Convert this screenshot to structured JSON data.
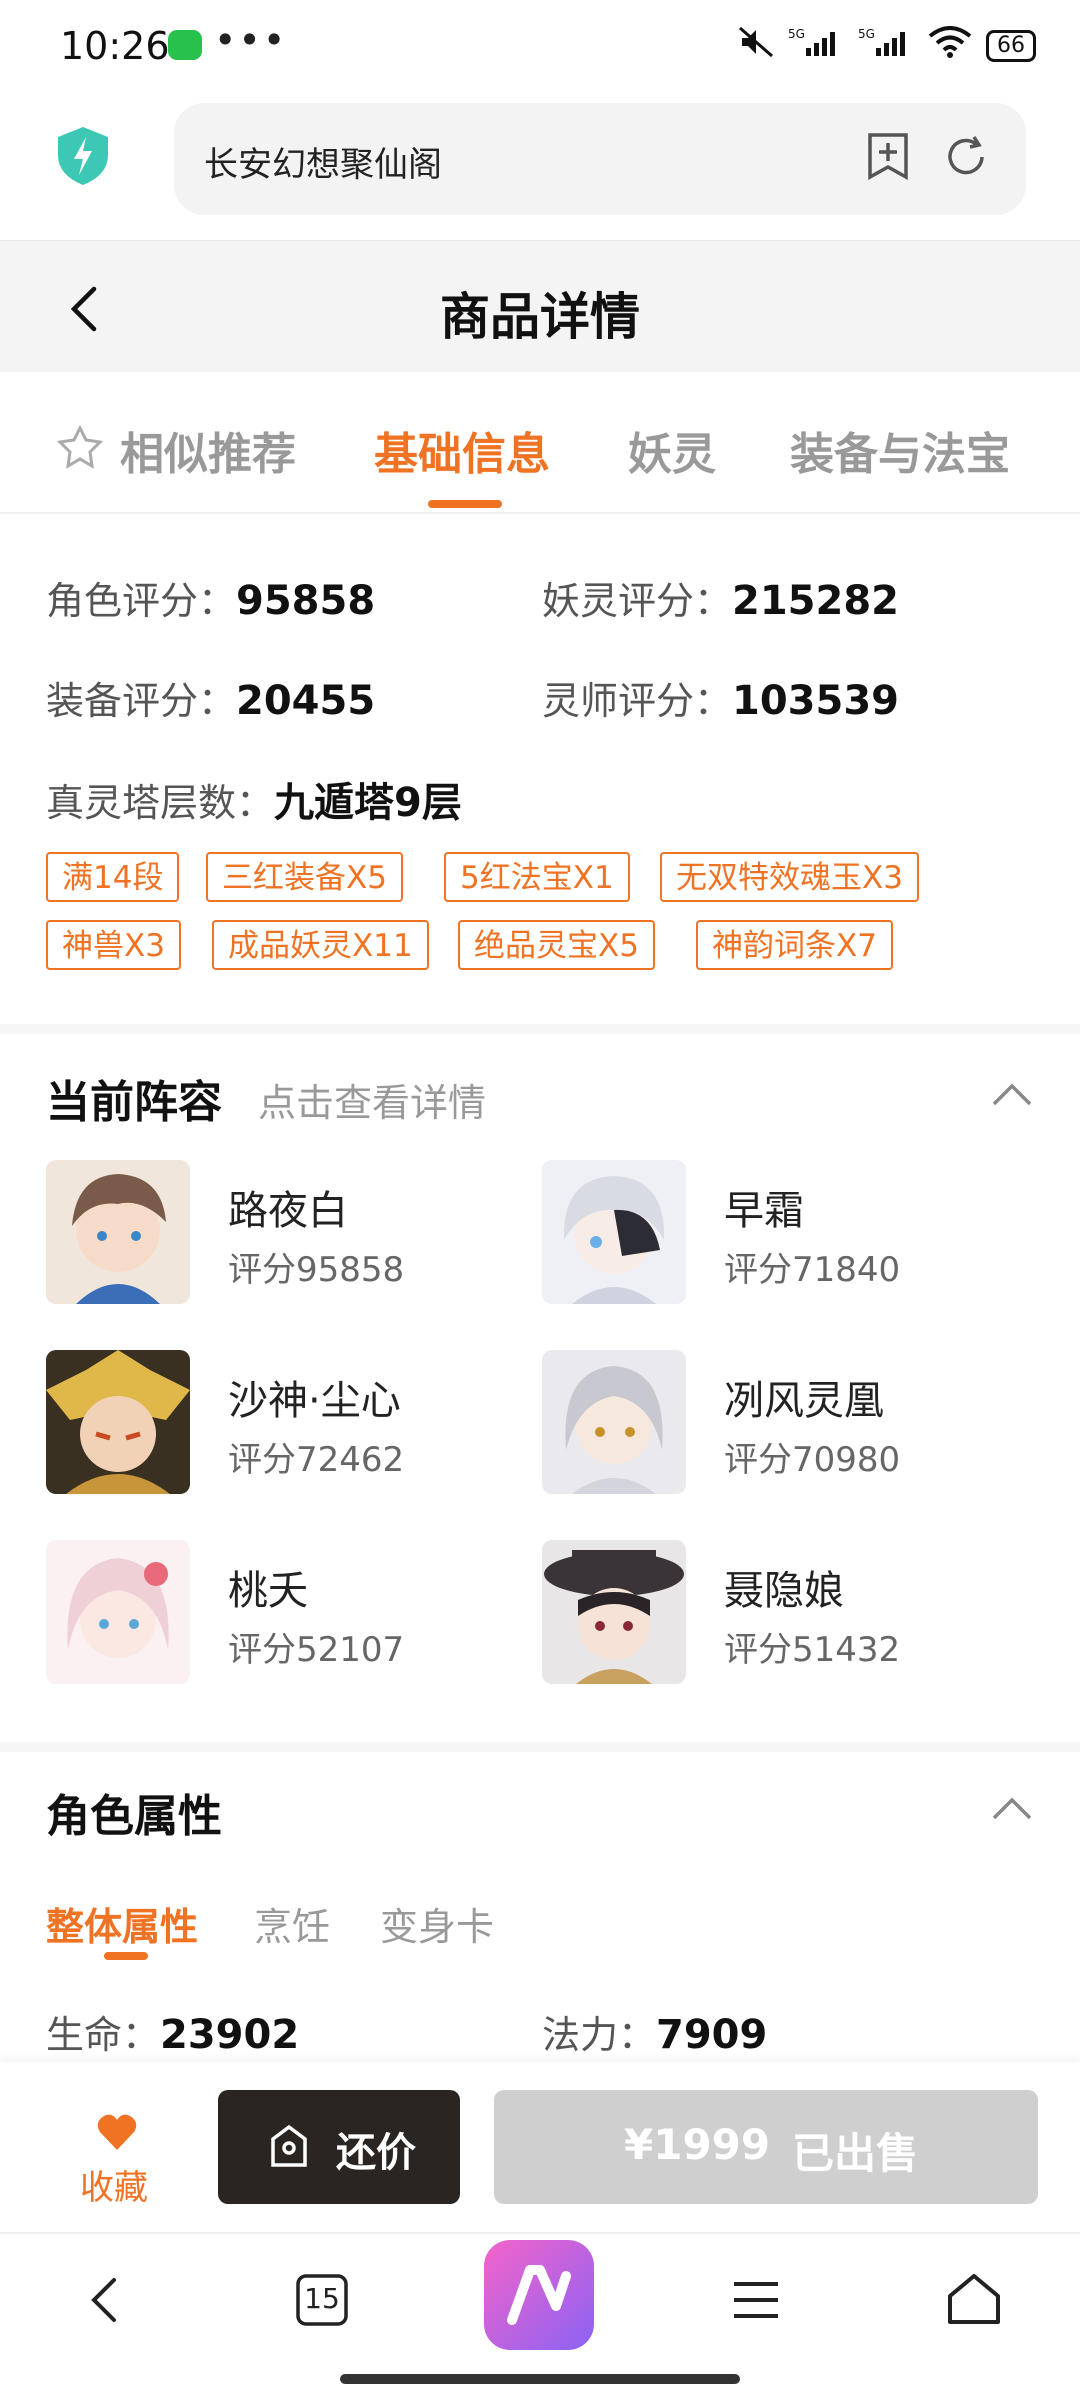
{
  "status_bar": {
    "time": "10:26",
    "dots": "•••",
    "battery": "66",
    "signal": "5G"
  },
  "browser": {
    "url_title": "长安幻想聚仙阁"
  },
  "header": {
    "title": "商品详情"
  },
  "tabs": [
    {
      "label": "相似推荐"
    },
    {
      "label": "基础信息"
    },
    {
      "label": "妖灵"
    },
    {
      "label": "装备与法宝"
    }
  ],
  "basic_info": {
    "role_score_label": "角色评分：",
    "role_score": "95858",
    "yaoling_score_label": "妖灵评分：",
    "yaoling_score": "215282",
    "equip_score_label": "装备评分：",
    "equip_score": "20455",
    "lingshi_score_label": "灵师评分：",
    "lingshi_score": "103539",
    "tower_label": "真灵塔层数：",
    "tower": "九遁塔9层"
  },
  "tags": [
    "满14段",
    "三红装备X5",
    "5红法宝X1",
    "无双特效魂玉X3",
    "神兽X3",
    "成品妖灵X11",
    "绝品灵宝X5",
    "神韵词条X7"
  ],
  "lineup": {
    "title": "当前阵容",
    "subtitle": "点击查看详情",
    "members": [
      {
        "name": "路夜白",
        "score": "评分95858",
        "color": "#7a5a48"
      },
      {
        "name": "早霜",
        "score": "评分71840",
        "color": "#d9dbe4"
      },
      {
        "name": "沙神·尘心",
        "score": "评分72462",
        "color": "#d8b24a"
      },
      {
        "name": "冽风灵凰",
        "score": "评分70980",
        "color": "#c8c8d0"
      },
      {
        "name": "桃夭",
        "score": "评分52107",
        "color": "#efd0d6"
      },
      {
        "name": "聂隐娘",
        "score": "评分51432",
        "color": "#3a3438"
      }
    ]
  },
  "attributes": {
    "title": "角色属性",
    "subtabs": [
      "整体属性",
      "烹饪",
      "变身卡"
    ],
    "life_label": "生命：",
    "life": "23902",
    "mana_label": "法力：",
    "mana": "7909"
  },
  "actions": {
    "favorite": "收藏",
    "bargain": "还价",
    "price": "¥1999",
    "sold": "已出售"
  },
  "nav": {
    "tabs_count": "15"
  },
  "colors": {
    "accent": "#f07323",
    "dark_button": "#2b2522",
    "disabled": "#cfcfcf"
  }
}
